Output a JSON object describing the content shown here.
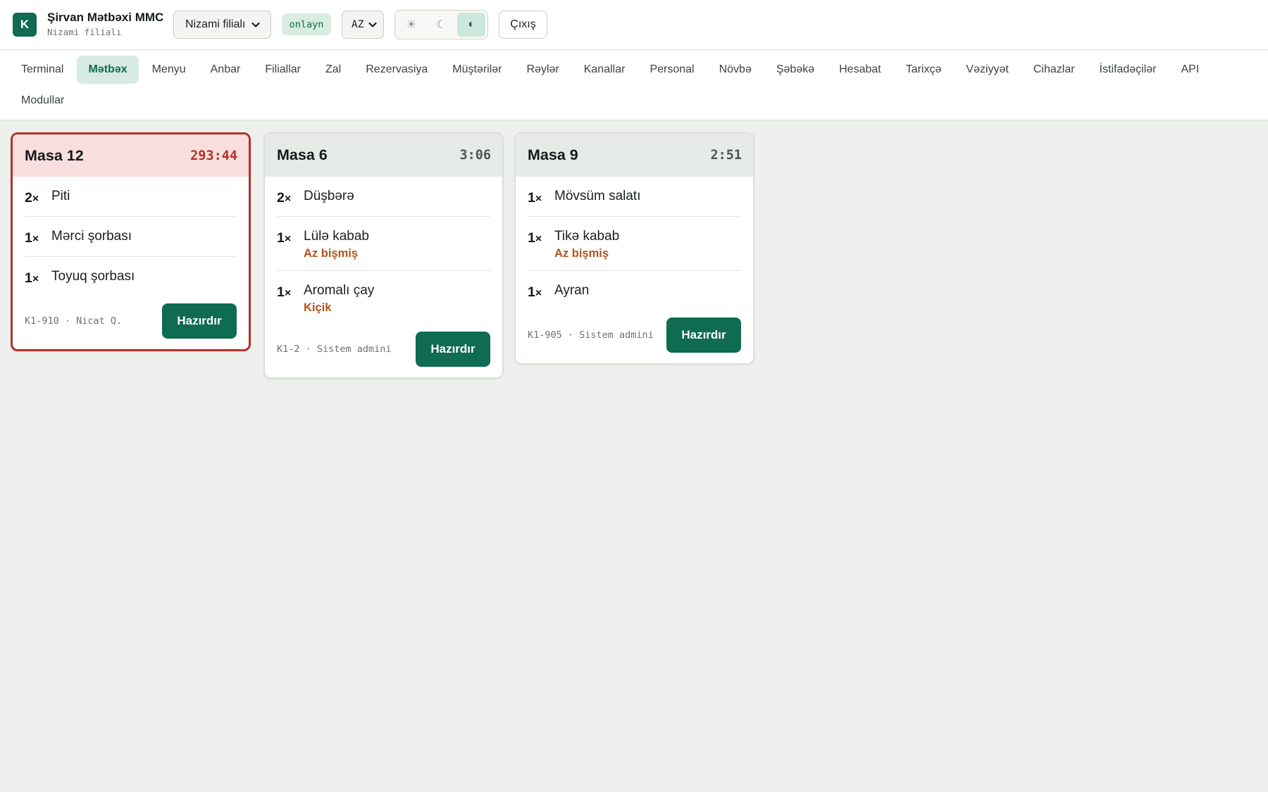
{
  "header": {
    "logo_letter": "K",
    "company": "Şirvan Mətbəxi MMC",
    "branch_sub": "Nizami filialı",
    "branch_select": "Nizami filialı",
    "status": "onlayn",
    "lang": "AZ",
    "theme_light": "☀",
    "theme_dark": "☾",
    "theme_auto": "◐",
    "logout": "Çıxış"
  },
  "nav": {
    "row1": [
      "Terminal",
      "Mətbəx",
      "Menyu",
      "Anbar",
      "Filiallar",
      "Zal",
      "Rezervasiya",
      "Müştərilər",
      "Rəylər",
      "Kanallar",
      "Personal",
      "Növbə",
      "Şəbəkə",
      "Hesabat",
      "Tarixçə",
      "Vəziyyət",
      "Cihazlar",
      "İstifadəçilər",
      "API"
    ],
    "row2": [
      "Modullar"
    ],
    "active": "Mətbəx"
  },
  "tickets": [
    {
      "table": "Masa 12",
      "timer": "293:44",
      "items": [
        {
          "qty": "2",
          "name": "Piti",
          "note": ""
        },
        {
          "qty": "1",
          "name": "Mərci şorbası",
          "note": ""
        },
        {
          "qty": "1",
          "name": "Toyuq şorbası",
          "note": ""
        }
      ],
      "meta": "K1-910 · Nicat Q.",
      "button": "Hazırdır"
    },
    {
      "table": "Masa 6",
      "timer": "3:06",
      "items": [
        {
          "qty": "2",
          "name": "Düşbərə",
          "note": ""
        },
        {
          "qty": "1",
          "name": "Lülə kabab",
          "note": "Az bişmiş"
        },
        {
          "qty": "1",
          "name": "Aromalı çay",
          "note": "Kiçik"
        }
      ],
      "meta": "K1-2 · Sistem admini",
      "button": "Hazırdır"
    },
    {
      "table": "Masa 9",
      "timer": "2:51",
      "items": [
        {
          "qty": "1",
          "name": "Mövsüm salatı",
          "note": ""
        },
        {
          "qty": "1",
          "name": "Tikə kabab",
          "note": "Az bişmiş"
        },
        {
          "qty": "1",
          "name": "Ayran",
          "note": ""
        }
      ],
      "meta": "K1-905 · Sistem admini",
      "button": "Hazırdır"
    }
  ],
  "colors": {
    "accent": "#0f6b52",
    "urgent": "#b3322c",
    "note": "#b3531d",
    "background": "#eef0ed"
  }
}
